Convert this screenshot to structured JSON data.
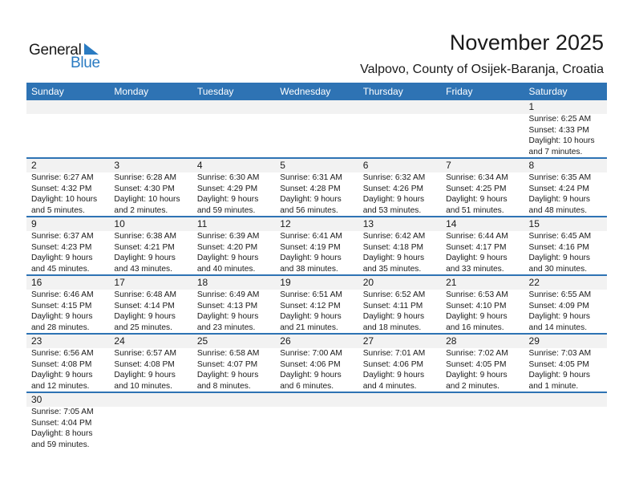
{
  "logo": {
    "line1": "General",
    "line2": "Blue",
    "icon": "triangle-flag-icon",
    "brand_color": "#2a7bc2"
  },
  "title": "November 2025",
  "location": "Valpovo, County of Osijek-Baranja, Croatia",
  "accent_color": "#2e73b4",
  "days_of_week": [
    "Sunday",
    "Monday",
    "Tuesday",
    "Wednesday",
    "Thursday",
    "Friday",
    "Saturday"
  ],
  "weeks": [
    [
      {
        "day": "",
        "sunrise": "",
        "sunset": "",
        "daylight1": "",
        "daylight2": ""
      },
      {
        "day": "",
        "sunrise": "",
        "sunset": "",
        "daylight1": "",
        "daylight2": ""
      },
      {
        "day": "",
        "sunrise": "",
        "sunset": "",
        "daylight1": "",
        "daylight2": ""
      },
      {
        "day": "",
        "sunrise": "",
        "sunset": "",
        "daylight1": "",
        "daylight2": ""
      },
      {
        "day": "",
        "sunrise": "",
        "sunset": "",
        "daylight1": "",
        "daylight2": ""
      },
      {
        "day": "",
        "sunrise": "",
        "sunset": "",
        "daylight1": "",
        "daylight2": ""
      },
      {
        "day": "1",
        "sunrise": "Sunrise: 6:25 AM",
        "sunset": "Sunset: 4:33 PM",
        "daylight1": "Daylight: 10 hours",
        "daylight2": "and 7 minutes."
      }
    ],
    [
      {
        "day": "2",
        "sunrise": "Sunrise: 6:27 AM",
        "sunset": "Sunset: 4:32 PM",
        "daylight1": "Daylight: 10 hours",
        "daylight2": "and 5 minutes."
      },
      {
        "day": "3",
        "sunrise": "Sunrise: 6:28 AM",
        "sunset": "Sunset: 4:30 PM",
        "daylight1": "Daylight: 10 hours",
        "daylight2": "and 2 minutes."
      },
      {
        "day": "4",
        "sunrise": "Sunrise: 6:30 AM",
        "sunset": "Sunset: 4:29 PM",
        "daylight1": "Daylight: 9 hours",
        "daylight2": "and 59 minutes."
      },
      {
        "day": "5",
        "sunrise": "Sunrise: 6:31 AM",
        "sunset": "Sunset: 4:28 PM",
        "daylight1": "Daylight: 9 hours",
        "daylight2": "and 56 minutes."
      },
      {
        "day": "6",
        "sunrise": "Sunrise: 6:32 AM",
        "sunset": "Sunset: 4:26 PM",
        "daylight1": "Daylight: 9 hours",
        "daylight2": "and 53 minutes."
      },
      {
        "day": "7",
        "sunrise": "Sunrise: 6:34 AM",
        "sunset": "Sunset: 4:25 PM",
        "daylight1": "Daylight: 9 hours",
        "daylight2": "and 51 minutes."
      },
      {
        "day": "8",
        "sunrise": "Sunrise: 6:35 AM",
        "sunset": "Sunset: 4:24 PM",
        "daylight1": "Daylight: 9 hours",
        "daylight2": "and 48 minutes."
      }
    ],
    [
      {
        "day": "9",
        "sunrise": "Sunrise: 6:37 AM",
        "sunset": "Sunset: 4:23 PM",
        "daylight1": "Daylight: 9 hours",
        "daylight2": "and 45 minutes."
      },
      {
        "day": "10",
        "sunrise": "Sunrise: 6:38 AM",
        "sunset": "Sunset: 4:21 PM",
        "daylight1": "Daylight: 9 hours",
        "daylight2": "and 43 minutes."
      },
      {
        "day": "11",
        "sunrise": "Sunrise: 6:39 AM",
        "sunset": "Sunset: 4:20 PM",
        "daylight1": "Daylight: 9 hours",
        "daylight2": "and 40 minutes."
      },
      {
        "day": "12",
        "sunrise": "Sunrise: 6:41 AM",
        "sunset": "Sunset: 4:19 PM",
        "daylight1": "Daylight: 9 hours",
        "daylight2": "and 38 minutes."
      },
      {
        "day": "13",
        "sunrise": "Sunrise: 6:42 AM",
        "sunset": "Sunset: 4:18 PM",
        "daylight1": "Daylight: 9 hours",
        "daylight2": "and 35 minutes."
      },
      {
        "day": "14",
        "sunrise": "Sunrise: 6:44 AM",
        "sunset": "Sunset: 4:17 PM",
        "daylight1": "Daylight: 9 hours",
        "daylight2": "and 33 minutes."
      },
      {
        "day": "15",
        "sunrise": "Sunrise: 6:45 AM",
        "sunset": "Sunset: 4:16 PM",
        "daylight1": "Daylight: 9 hours",
        "daylight2": "and 30 minutes."
      }
    ],
    [
      {
        "day": "16",
        "sunrise": "Sunrise: 6:46 AM",
        "sunset": "Sunset: 4:15 PM",
        "daylight1": "Daylight: 9 hours",
        "daylight2": "and 28 minutes."
      },
      {
        "day": "17",
        "sunrise": "Sunrise: 6:48 AM",
        "sunset": "Sunset: 4:14 PM",
        "daylight1": "Daylight: 9 hours",
        "daylight2": "and 25 minutes."
      },
      {
        "day": "18",
        "sunrise": "Sunrise: 6:49 AM",
        "sunset": "Sunset: 4:13 PM",
        "daylight1": "Daylight: 9 hours",
        "daylight2": "and 23 minutes."
      },
      {
        "day": "19",
        "sunrise": "Sunrise: 6:51 AM",
        "sunset": "Sunset: 4:12 PM",
        "daylight1": "Daylight: 9 hours",
        "daylight2": "and 21 minutes."
      },
      {
        "day": "20",
        "sunrise": "Sunrise: 6:52 AM",
        "sunset": "Sunset: 4:11 PM",
        "daylight1": "Daylight: 9 hours",
        "daylight2": "and 18 minutes."
      },
      {
        "day": "21",
        "sunrise": "Sunrise: 6:53 AM",
        "sunset": "Sunset: 4:10 PM",
        "daylight1": "Daylight: 9 hours",
        "daylight2": "and 16 minutes."
      },
      {
        "day": "22",
        "sunrise": "Sunrise: 6:55 AM",
        "sunset": "Sunset: 4:09 PM",
        "daylight1": "Daylight: 9 hours",
        "daylight2": "and 14 minutes."
      }
    ],
    [
      {
        "day": "23",
        "sunrise": "Sunrise: 6:56 AM",
        "sunset": "Sunset: 4:08 PM",
        "daylight1": "Daylight: 9 hours",
        "daylight2": "and 12 minutes."
      },
      {
        "day": "24",
        "sunrise": "Sunrise: 6:57 AM",
        "sunset": "Sunset: 4:08 PM",
        "daylight1": "Daylight: 9 hours",
        "daylight2": "and 10 minutes."
      },
      {
        "day": "25",
        "sunrise": "Sunrise: 6:58 AM",
        "sunset": "Sunset: 4:07 PM",
        "daylight1": "Daylight: 9 hours",
        "daylight2": "and 8 minutes."
      },
      {
        "day": "26",
        "sunrise": "Sunrise: 7:00 AM",
        "sunset": "Sunset: 4:06 PM",
        "daylight1": "Daylight: 9 hours",
        "daylight2": "and 6 minutes."
      },
      {
        "day": "27",
        "sunrise": "Sunrise: 7:01 AM",
        "sunset": "Sunset: 4:06 PM",
        "daylight1": "Daylight: 9 hours",
        "daylight2": "and 4 minutes."
      },
      {
        "day": "28",
        "sunrise": "Sunrise: 7:02 AM",
        "sunset": "Sunset: 4:05 PM",
        "daylight1": "Daylight: 9 hours",
        "daylight2": "and 2 minutes."
      },
      {
        "day": "29",
        "sunrise": "Sunrise: 7:03 AM",
        "sunset": "Sunset: 4:05 PM",
        "daylight1": "Daylight: 9 hours",
        "daylight2": "and 1 minute."
      }
    ],
    [
      {
        "day": "30",
        "sunrise": "Sunrise: 7:05 AM",
        "sunset": "Sunset: 4:04 PM",
        "daylight1": "Daylight: 8 hours",
        "daylight2": "and 59 minutes."
      }
    ]
  ]
}
